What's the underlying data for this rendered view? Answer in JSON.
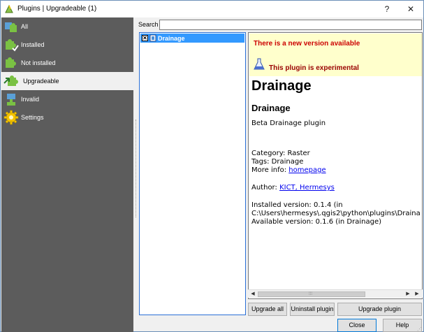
{
  "window": {
    "title": "Plugins | Upgradeable (1)",
    "help_glyph": "?",
    "close_glyph": "✕"
  },
  "sidebar": {
    "items": [
      {
        "label": "All",
        "icon": "puzzle-all-icon"
      },
      {
        "label": "Installed",
        "icon": "puzzle-installed-icon"
      },
      {
        "label": "Not installed",
        "icon": "puzzle-not-installed-icon"
      },
      {
        "label": "Upgradeable",
        "icon": "puzzle-upgradeable-icon",
        "selected": true
      },
      {
        "label": "Invalid",
        "icon": "puzzle-invalid-icon"
      },
      {
        "label": "Settings",
        "icon": "gear-icon"
      }
    ]
  },
  "search": {
    "label": "Search",
    "value": ""
  },
  "plugin_list": {
    "items": [
      {
        "label": "Drainage",
        "checked": true,
        "check_glyph": "✕"
      }
    ]
  },
  "details": {
    "banner_new_version": "There is a new version available",
    "banner_experimental": "This plugin is experimental",
    "title": "Drainage",
    "subtitle": "Drainage",
    "description": "Beta Drainage plugin",
    "category": "Category: Raster",
    "tags": "Tags: Drainage",
    "more_info_label": "More info:",
    "more_info_link": "homepage",
    "author_label": "Author:",
    "author_link": "KICT, Hermesys",
    "installed_version_line1": "Installed version: 0.1.4 (in",
    "installed_version_line2": "C:\\Users\\hermesys\\.qgis2\\python\\plugins\\Draina",
    "available_version": "Available version: 0.1.6 (in Drainage)"
  },
  "scrollbar": {
    "left_arrow": "◀",
    "right_arrow": "▶",
    "grip": "⁞⁞⁞"
  },
  "buttons": {
    "upgrade_all": "Upgrade all",
    "uninstall": "Uninstall plugin",
    "upgrade": "Upgrade plugin",
    "close": "Close",
    "help": "Help"
  },
  "colors": {
    "sidebar_bg": "#5c5c5c",
    "selection": "#3399ff",
    "banner_bg": "#ffffcc",
    "banner_red": "#cc0000",
    "link": "#0000ee"
  }
}
